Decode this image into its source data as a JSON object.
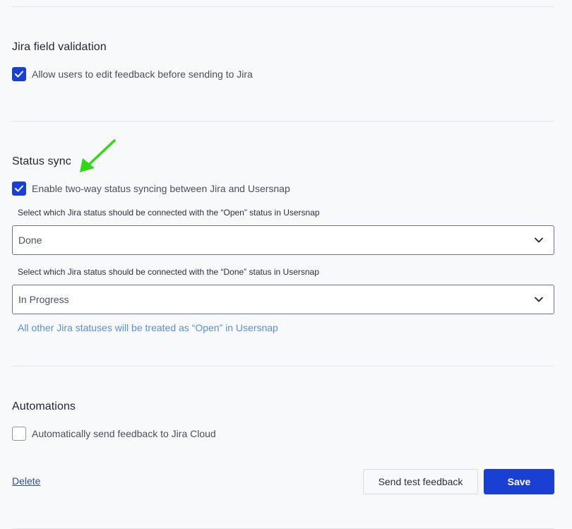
{
  "jira_validation": {
    "title": "Jira field validation",
    "allow_edit_label": "Allow users to edit feedback before sending to Jira",
    "allow_edit_checked": true
  },
  "status_sync": {
    "title": "Status sync",
    "two_way_label": "Enable two-way status syncing between Jira and Usersnap",
    "two_way_checked": true,
    "open_select_label": "Select which Jira status should be connected with the “Open” status in Usersnap",
    "open_select_value": "Done",
    "done_select_label": "Select which Jira status should be connected with the “Done” status in Usersnap",
    "done_select_value": "In Progress",
    "hint": "All other Jira statuses will be treated as “Open” in Usersnap"
  },
  "automations": {
    "title": "Automations",
    "auto_send_label": "Automatically send feedback to Jira Cloud",
    "auto_send_checked": false
  },
  "footer": {
    "delete_label": "Delete",
    "send_test_label": "Send test feedback",
    "save_label": "Save"
  },
  "colors": {
    "accent": "#1b3fd3",
    "hint": "#5a8ed8",
    "annotation_arrow": "#33d619"
  },
  "icons": {
    "checkbox_check": "check-icon",
    "select_chevron": "chevron-down-icon",
    "annotation": "green-arrow-icon"
  }
}
